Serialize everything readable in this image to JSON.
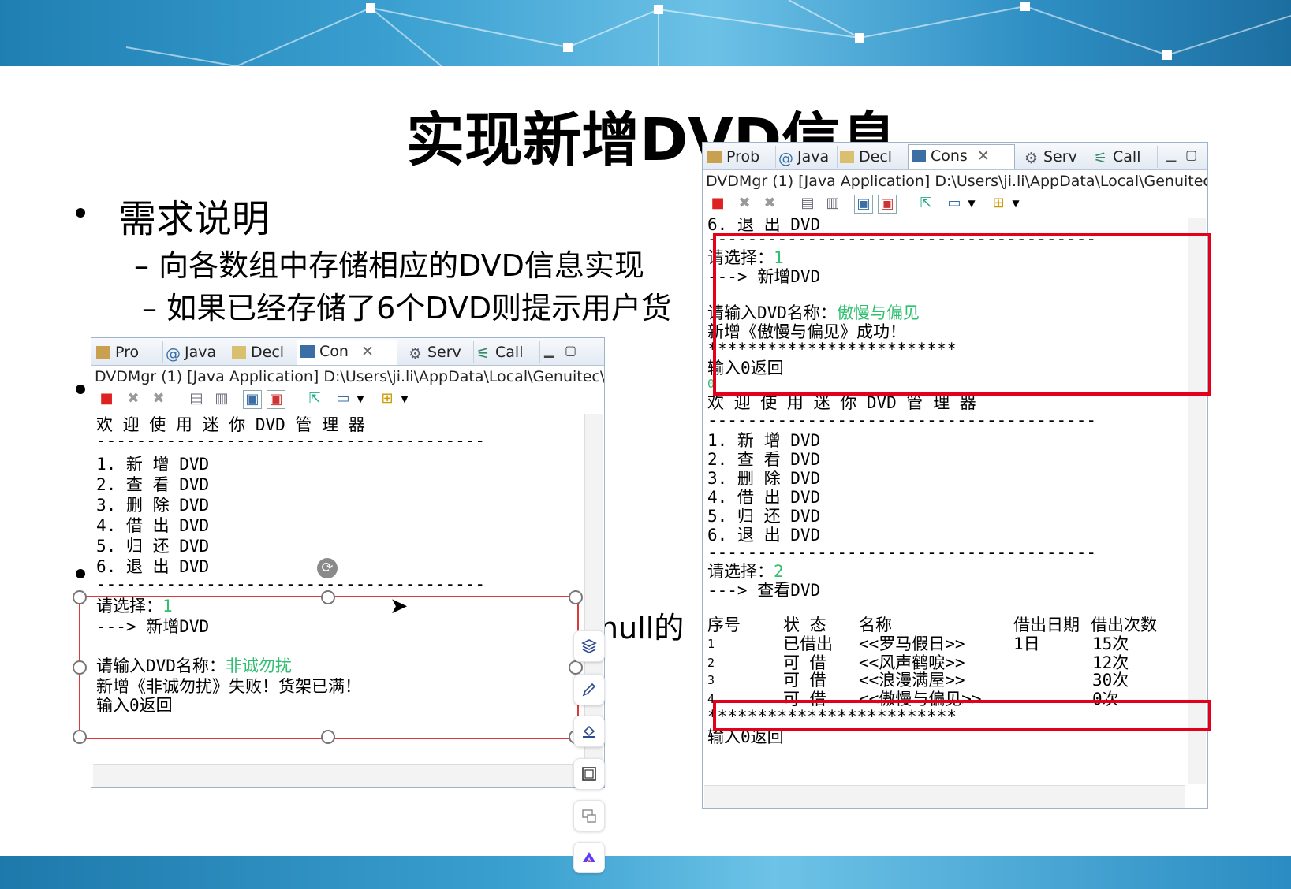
{
  "slide": {
    "title": "实现新增DVD信息",
    "bullet1": "需求说明",
    "sub1": "– 向各数组中存储相应的DVD信息实现",
    "sub2": "– 如果已经存储了6个DVD则提示用户货",
    "null_fragment": "null的"
  },
  "left_console": {
    "tabs": [
      "Pro",
      "Java",
      "Decl",
      "Con",
      "Serv",
      "Call"
    ],
    "active_tab": "Con",
    "path": "DVDMgr (1) [Java Application] D:\\Users\\ji.li\\AppData\\Local\\Genuitec\\",
    "lines": {
      "l1": "欢 迎 使 用 迷 你 DVD 管 理 器",
      "l2": "---------------------------------------",
      "l3": "1. 新 增 DVD",
      "l4": "2. 查 看 DVD",
      "l5": "3. 删 除 DVD",
      "l6": "4. 借 出 DVD",
      "l7": "5. 归 还 DVD",
      "l8": "6. 退 出 DVD",
      "l9": "---------------------------------------",
      "l10": "请选择：",
      "l10_input": "1",
      "l11": "---> 新增DVD",
      "l12": "请输入DVD名称：",
      "l12_input": "非诚勿扰",
      "l13": "新增《非诚勿扰》失败！货架已满！",
      "l14": "输入0返回"
    }
  },
  "right_console": {
    "tabs": [
      "Prob",
      "Java",
      "Decl",
      "Cons",
      "Serv",
      "Call"
    ],
    "active_tab": "Cons",
    "path": "DVDMgr (1) [Java Application] D:\\Users\\ji.li\\AppData\\Local\\Genuitec\\Co",
    "lines": {
      "r1": "6. 退 出 DVD",
      "r2": "---------------------------------------",
      "r3": "请选择：",
      "r3_input": "1",
      "r4": "---> 新增DVD",
      "r5": "请输入DVD名称：",
      "r5_input": "傲慢与偏见",
      "r6": "新增《傲慢与偏见》成功！",
      "r7": "*************************",
      "r8": "输入0返回",
      "r9": "0",
      "r10": "欢 迎 使 用 迷 你 DVD 管 理 器",
      "r11": "---------------------------------------",
      "r12": "1. 新 增 DVD",
      "r13": "2. 查 看 DVD",
      "r14": "3. 删 除 DVD",
      "r15": "4. 借 出 DVD",
      "r16": "5. 归 还 DVD",
      "r17": "6. 退 出 DVD",
      "r18": "---------------------------------------",
      "r19": "请选择：",
      "r19_input": "2",
      "r20": "---> 查看DVD",
      "r30": "*************************",
      "r31": "输入0返回"
    },
    "table": {
      "headers": [
        "序号",
        "状 态",
        "名称",
        "借出日期",
        "借出次数"
      ],
      "rows": [
        [
          "1",
          "已借出",
          "<<罗马假日>>",
          "1日",
          "15次"
        ],
        [
          "2",
          "可 借",
          "<<风声鹤唳>>",
          "",
          "12次"
        ],
        [
          "3",
          "可 借",
          "<<浪漫满屋>>",
          "",
          "30次"
        ],
        [
          "4",
          "可 借",
          "<<傲慢与偏见>>",
          "",
          "0次"
        ]
      ]
    }
  },
  "colors": {
    "banner": "#2f8fc4",
    "highlight": "#e3001b",
    "input_green": "#2fbf6f"
  },
  "side_tools": [
    "layers-icon",
    "pen-icon",
    "fill-icon",
    "frame-icon",
    "text-box-icon",
    "brand-logo-icon"
  ]
}
